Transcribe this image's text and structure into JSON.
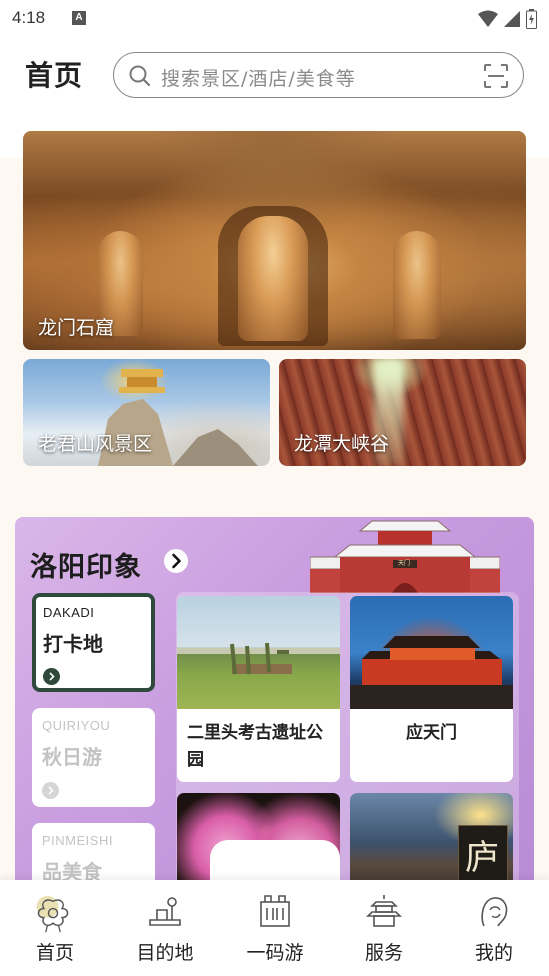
{
  "status_bar": {
    "time": "4:18",
    "a_icon": "A"
  },
  "header": {
    "title": "首页",
    "search_placeholder": "搜索景区/酒店/美食等"
  },
  "hero": {
    "main": {
      "label": "龙门石窟"
    },
    "sub": [
      {
        "label": "老君山风景区"
      },
      {
        "label": "龙潭大峡谷"
      }
    ]
  },
  "impression": {
    "title": "洛阳印象",
    "gate_sign": "天门",
    "tabs": [
      {
        "en": "DAKADI",
        "cn": "打卡地",
        "active": true
      },
      {
        "en": "QUIRIYOU",
        "cn": "秋日游",
        "active": false
      },
      {
        "en": "PINMEISHI",
        "cn": "品美食",
        "active": false
      }
    ],
    "spots": [
      {
        "name": "二里头考古遗址公园"
      },
      {
        "name": "应天门"
      },
      {
        "name": ""
      },
      {
        "name": ""
      }
    ],
    "night_sign": "庐"
  },
  "bottom_nav": [
    {
      "label": "首页",
      "icon": "peony-home-icon",
      "active": true
    },
    {
      "label": "目的地",
      "icon": "destination-icon",
      "active": false
    },
    {
      "label": "一码游",
      "icon": "one-code-tour-icon",
      "active": false
    },
    {
      "label": "服务",
      "icon": "service-pagoda-icon",
      "active": false
    },
    {
      "label": "我的",
      "icon": "profile-icon",
      "active": false
    }
  ],
  "colors": {
    "accent_dark_green": "#2f4a3d",
    "impression_purple": "#c99ddf"
  }
}
